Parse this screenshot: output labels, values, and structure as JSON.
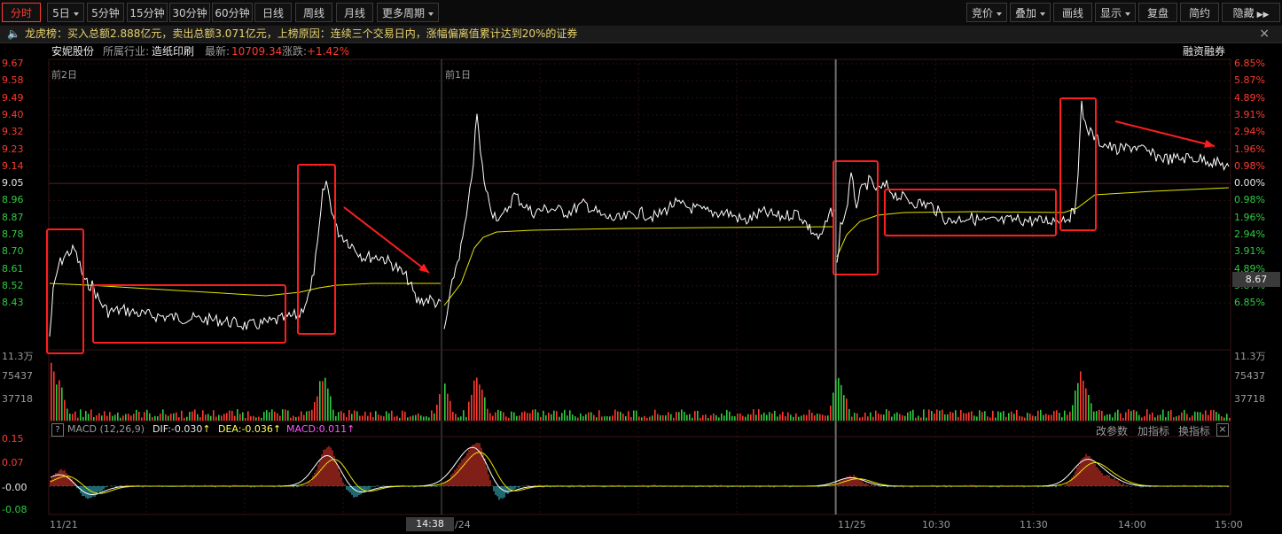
{
  "toolbar": {
    "left_tabs": [
      "分时",
      "5日",
      "5分钟",
      "15分钟",
      "30分钟",
      "60分钟",
      "日线",
      "周线",
      "月线",
      "更多周期"
    ],
    "right_tabs": [
      "竞价",
      "叠加",
      "画线",
      "显示",
      "复盘",
      "简约",
      "隐藏"
    ]
  },
  "notice": {
    "text": "龙虎榜：买入总额2.888亿元，卖出总额3.071亿元，上榜原因：连续三个交易日内，涨幅偏离值累计达到20%的证券",
    "close": "×"
  },
  "info": {
    "stock_name": "安妮股份",
    "industry_label": "所属行业:",
    "industry": "造纸印刷",
    "latest_label": "最新:",
    "latest": "10709.34",
    "change_label": "涨跌:",
    "change": "+1.42%",
    "margin": "融资融券"
  },
  "day_labels": {
    "day1": "前2日",
    "day2": "前1日"
  },
  "price_axis": {
    "left": [
      {
        "text": "9.67",
        "color": "#ff3b30"
      },
      {
        "text": "9.58",
        "color": "#ff3b30"
      },
      {
        "text": "9.49",
        "color": "#ff3b30"
      },
      {
        "text": "9.40",
        "color": "#ff3b30"
      },
      {
        "text": "9.32",
        "color": "#ff3b30"
      },
      {
        "text": "9.23",
        "color": "#ff3b30"
      },
      {
        "text": "9.14",
        "color": "#ff3b30"
      },
      {
        "text": "9.05",
        "color": "#e6e6e6"
      },
      {
        "text": "8.96",
        "color": "#2ecc40"
      },
      {
        "text": "8.87",
        "color": "#2ecc40"
      },
      {
        "text": "8.78",
        "color": "#2ecc40"
      },
      {
        "text": "8.70",
        "color": "#2ecc40"
      },
      {
        "text": "8.61",
        "color": "#2ecc40"
      },
      {
        "text": "8.52",
        "color": "#2ecc40"
      },
      {
        "text": "8.43",
        "color": "#2ecc40"
      }
    ],
    "right": [
      {
        "text": "6.85%",
        "color": "#ff3b30"
      },
      {
        "text": "5.87%",
        "color": "#ff3b30"
      },
      {
        "text": "4.89%",
        "color": "#ff3b30"
      },
      {
        "text": "3.91%",
        "color": "#ff3b30"
      },
      {
        "text": "2.94%",
        "color": "#ff3b30"
      },
      {
        "text": "1.96%",
        "color": "#ff3b30"
      },
      {
        "text": "0.98%",
        "color": "#ff3b30"
      },
      {
        "text": "0.00%",
        "color": "#e6e6e6"
      },
      {
        "text": "0.98%",
        "color": "#2ecc40"
      },
      {
        "text": "1.96%",
        "color": "#2ecc40"
      },
      {
        "text": "2.94%",
        "color": "#2ecc40"
      },
      {
        "text": "3.91%",
        "color": "#2ecc40"
      },
      {
        "text": "4.89%",
        "color": "#2ecc40"
      },
      {
        "text": "5.87%",
        "color": "#2ecc40"
      },
      {
        "text": "6.85%",
        "color": "#2ecc40"
      }
    ],
    "current_price": "8.67"
  },
  "volume_axis": {
    "left": [
      "11.3万",
      "75437",
      "37718"
    ],
    "right": [
      "11.3万",
      "75437",
      "37718"
    ]
  },
  "macd": {
    "help": "?",
    "title": "MACD (12,26,9)",
    "dif": "DIF:-0.030",
    "dea": "DEA:-0.036",
    "macd": "MACD:0.011",
    "arrow": "↑",
    "buttons": [
      "改参数",
      "加指标",
      "换指标"
    ],
    "close": "×",
    "axis": [
      "0.15",
      "0.07",
      "-0.00",
      "-0.08"
    ]
  },
  "time_axis": {
    "labels": [
      "11/21",
      "/24",
      "11/25",
      "10:30",
      "11:30",
      "14:00",
      "15:00"
    ],
    "cursor": "14:38"
  },
  "colors": {
    "up": "#ff3b30",
    "down": "#2ecc40",
    "price_line": "#ffffff",
    "avg_line": "#e6e600",
    "highlight_box": "#ff1e1e"
  }
}
